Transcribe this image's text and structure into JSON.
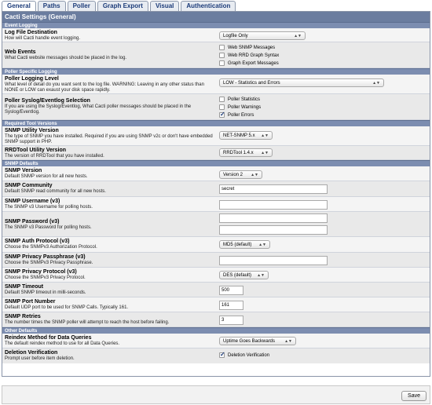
{
  "tabs": [
    "General",
    "Paths",
    "Poller",
    "Graph Export",
    "Visual",
    "Authentication"
  ],
  "panel_title": "Cacti Settings (General)",
  "sections": {
    "event_logging": "Event Logging",
    "poller_logging": "Poller Specific Logging",
    "tool_versions": "Required Tool Versions",
    "snmp_defaults": "SNMP Defaults",
    "other_defaults": "Other Defaults"
  },
  "fields": {
    "log_dest": {
      "title": "Log File Destination",
      "desc": "How will Cacti handle event logging.",
      "value": "Logfile Only"
    },
    "web_events": {
      "title": "Web Events",
      "desc": "What Cacti website messages should be placed in the log.",
      "options": [
        {
          "label": "Web SNMP Messages",
          "checked": false
        },
        {
          "label": "Web RRD Graph Syntax",
          "checked": false
        },
        {
          "label": "Graph Export Messages",
          "checked": false
        }
      ]
    },
    "poller_level": {
      "title": "Poller Logging Level",
      "desc": "What level of detail do you want sent to the log file. WARNING: Leaving in any other status than NONE or LOW can exaust your disk space rapidly.",
      "value": "LOW - Statistics and Errors"
    },
    "poller_syslog": {
      "title": "Poller Syslog/Eventlog Selection",
      "desc": "If you are using the Syslog/Eventlog, What Cacti poller messages should be placed in the Syslog/Eventlog.",
      "options": [
        {
          "label": "Poller Statistics",
          "checked": false
        },
        {
          "label": "Poller Warnings",
          "checked": false
        },
        {
          "label": "Poller Errors",
          "checked": true
        }
      ]
    },
    "snmp_utility": {
      "title": "SNMP Utility Version",
      "desc": "The type of SNMP you have installed. Required if you are using SNMP v2c or don't have embedded SNMP support in PHP.",
      "value": "NET-SNMP 5.x"
    },
    "rrdtool": {
      "title": "RRDTool Utility Version",
      "desc": "The version of RRDTool that you have installed.",
      "value": "RRDTool 1.4.x"
    },
    "snmp_version": {
      "title": "SNMP Version",
      "desc": "Default SNMP version for all new hosts.",
      "value": "Version 2"
    },
    "snmp_community": {
      "title": "SNMP Community",
      "desc": "Default SNMP read community for all new hosts.",
      "value": "secret"
    },
    "snmp_username": {
      "title": "SNMP Username (v3)",
      "desc": "The SNMP v3 Username for polling hosts.",
      "value": ""
    },
    "snmp_password": {
      "title": "SNMP Password (v3)",
      "desc": "The SNMP v3 Password for polling hosts.",
      "value": ""
    },
    "snmp_auth": {
      "title": "SNMP Auth Protocol (v3)",
      "desc": "Choose the SNMPv3 Authorization Protocol.",
      "value": "MD5 (default)"
    },
    "snmp_priv_pass": {
      "title": "SNMP Privacy Passphrase (v3)",
      "desc": "Choose the SNMPv3 Privacy Passphrase.",
      "value": ""
    },
    "snmp_priv_proto": {
      "title": "SNMP Privacy Protocol (v3)",
      "desc": "Choose the SNMPv3 Privacy Protocol.",
      "value": "DES (default)"
    },
    "snmp_timeout": {
      "title": "SNMP Timeout",
      "desc": "Default SNMP timeout in milli-seconds.",
      "value": "500"
    },
    "snmp_port": {
      "title": "SNMP Port Number",
      "desc": "Default UDP port to be used for SNMP Calls. Typically 161.",
      "value": "161"
    },
    "snmp_retries": {
      "title": "SNMP Retries",
      "desc": "The number times the SNMP poller will attempt to reach the host before failing.",
      "value": "3"
    },
    "reindex": {
      "title": "Reindex Method for Data Queries",
      "desc": "The default reindex method to use for all Data Queries.",
      "value": "Uptime Goes Backwards"
    },
    "deletion": {
      "title": "Deletion Verification",
      "desc": "Prompt user before item deletion.",
      "option": {
        "label": "Deletion Verification",
        "checked": true
      }
    }
  },
  "save_label": "Save"
}
